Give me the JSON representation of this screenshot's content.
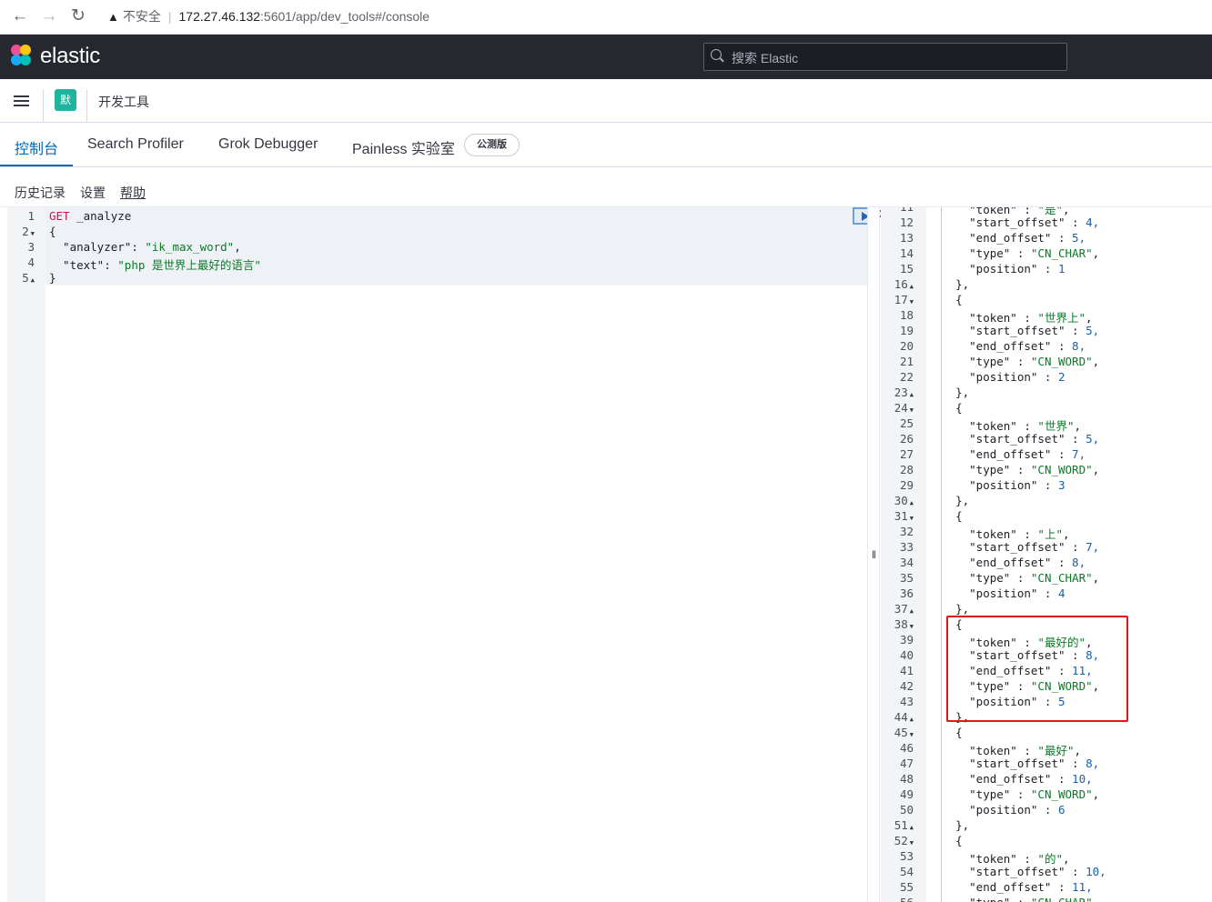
{
  "browser": {
    "security_label": "不安全",
    "url_host": "172.27.46.132",
    "url_path": ":5601/app/dev_tools#/console"
  },
  "header": {
    "brand": "elastic",
    "search_placeholder": "搜索 Elastic"
  },
  "breadcrumb": {
    "space_initial": "默",
    "page": "开发工具"
  },
  "tabs": [
    {
      "label": "控制台",
      "active": true
    },
    {
      "label": "Search Profiler",
      "active": false
    },
    {
      "label": "Grok Debugger",
      "active": false
    },
    {
      "label": "Painless 实验室",
      "active": false
    }
  ],
  "beta_badge": "公测版",
  "console_menu": {
    "history": "历史记录",
    "settings": "设置",
    "help": "帮助"
  },
  "request": {
    "line_numbers": [
      "1",
      "2",
      "3",
      "4",
      "5"
    ],
    "method": "GET",
    "endpoint": " _analyze",
    "open_brace": "{",
    "analyzer_key": "  \"analyzer\"",
    "analyzer_val": "\"ik_max_word\"",
    "text_key": "  \"text\"",
    "text_val": "\"php 是世界上最好的语言\"",
    "close_brace": "}"
  },
  "response": {
    "first_line": 11,
    "lines": [
      "      \"token\" : \"是\",",
      "      \"start_offset\" : 4,",
      "      \"end_offset\" : 5,",
      "      \"type\" : \"CN_CHAR\",",
      "      \"position\" : 1",
      "    },",
      "    {",
      "      \"token\" : \"世界上\",",
      "      \"start_offset\" : 5,",
      "      \"end_offset\" : 8,",
      "      \"type\" : \"CN_WORD\",",
      "      \"position\" : 2",
      "    },",
      "    {",
      "      \"token\" : \"世界\",",
      "      \"start_offset\" : 5,",
      "      \"end_offset\" : 7,",
      "      \"type\" : \"CN_WORD\",",
      "      \"position\" : 3",
      "    },",
      "    {",
      "      \"token\" : \"上\",",
      "      \"start_offset\" : 7,",
      "      \"end_offset\" : 8,",
      "      \"type\" : \"CN_CHAR\",",
      "      \"position\" : 4",
      "    },",
      "    {",
      "      \"token\" : \"最好的\",",
      "      \"start_offset\" : 8,",
      "      \"end_offset\" : 11,",
      "      \"type\" : \"CN_WORD\",",
      "      \"position\" : 5",
      "    },",
      "    {",
      "      \"token\" : \"最好\",",
      "      \"start_offset\" : 8,",
      "      \"end_offset\" : 10,",
      "      \"type\" : \"CN_WORD\",",
      "      \"position\" : 6",
      "    },",
      "    {",
      "      \"token\" : \"的\",",
      "      \"start_offset\" : 10,",
      "      \"end_offset\" : 11,",
      "      \"type\" : \"CN_CHAR\","
    ]
  }
}
